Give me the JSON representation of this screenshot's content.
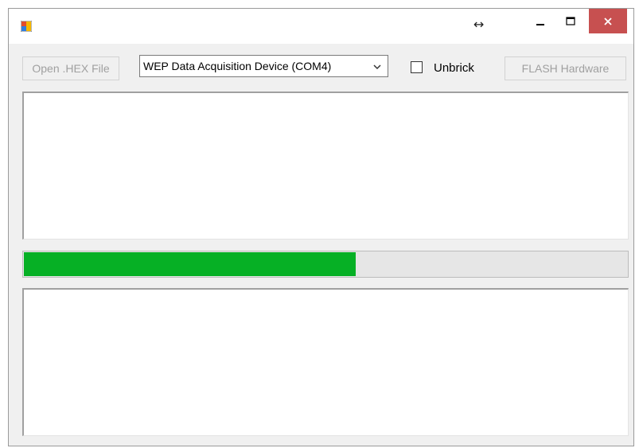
{
  "titlebar": {
    "resize_glyph": "↔",
    "minimize_glyph": "–",
    "maximize_glyph": "☐",
    "close_glyph": "✕"
  },
  "toolbar": {
    "open_label": "Open .HEX File",
    "device_selected": "WEP Data Acquisition Device (COM4)",
    "unbrick_label": "Unbrick",
    "unbrick_checked": false,
    "flash_label": "FLASH Hardware"
  },
  "progress": {
    "fraction": 0.55
  },
  "output_top": "",
  "output_bottom": "",
  "colors": {
    "progress_fill": "#06b025",
    "close_button": "#c75050",
    "disabled_text": "#a0a0a0"
  },
  "icons": [
    "app-icon",
    "resize-arrows-icon",
    "minimize-icon",
    "maximize-icon",
    "close-icon",
    "chevron-down-icon"
  ]
}
